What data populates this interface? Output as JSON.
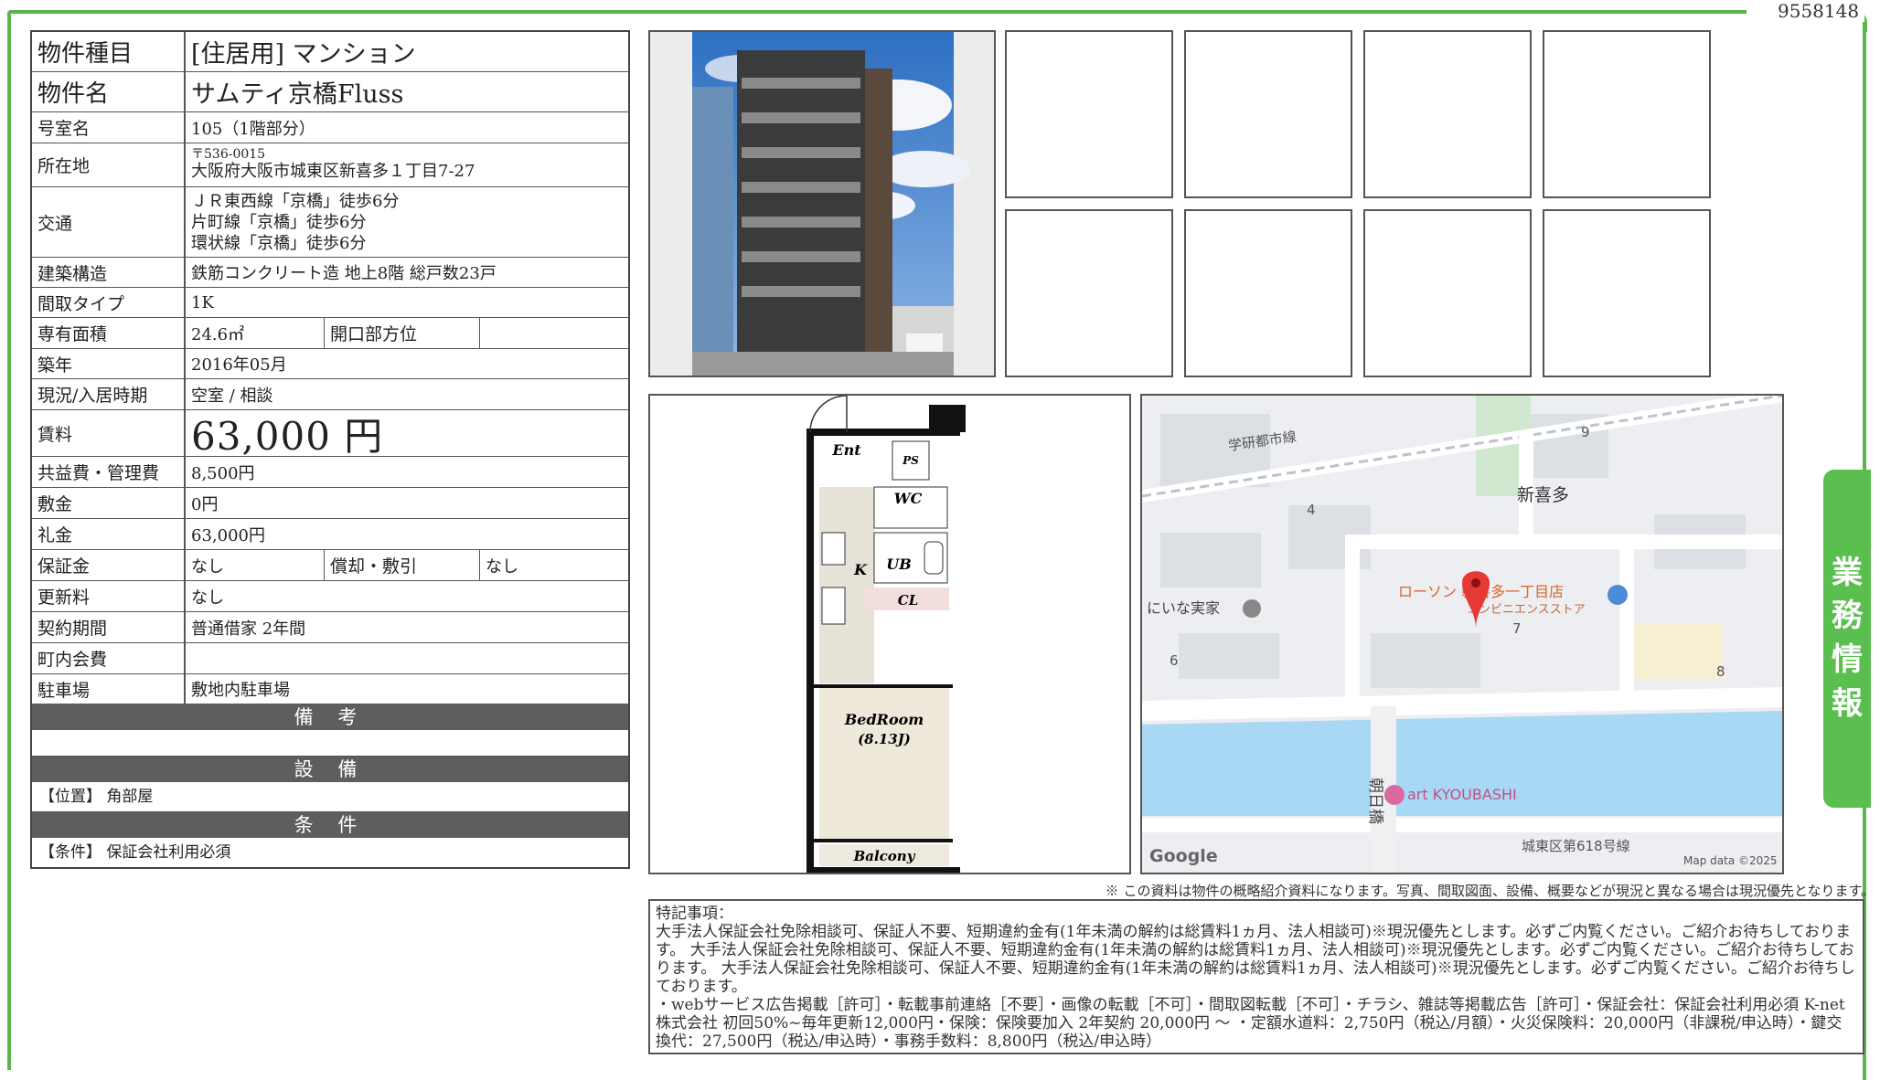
{
  "doc_id": "9558148",
  "side_tab": [
    "業",
    "務",
    "情",
    "報"
  ],
  "property": {
    "type_label": "物件種目",
    "type_value": "[住居用] マンション",
    "name_label": "物件名",
    "name_value": "サムティ京橋Fluss",
    "room_label": "号室名",
    "room_value": "105（1階部分）",
    "address_label": "所在地",
    "postal": "〒536-0015",
    "address": "大阪府大阪市城東区新喜多１丁目7-27",
    "access_label": "交通",
    "access": [
      "ＪＲ東西線「京橋」徒歩6分",
      "片町線「京橋」徒歩6分",
      "環状線「京橋」徒歩6分"
    ],
    "structure_label": "建築構造",
    "structure_value": "鉄筋コンクリート造 地上8階 総戸数23戸",
    "layout_label": "間取タイプ",
    "layout_value": "1K",
    "area_label": "専有面積",
    "area_value": "24.6㎡",
    "direction_label": "開口部方位",
    "direction_value": "",
    "built_label": "築年",
    "built_value": "2016年05月",
    "status_label": "現況/入居時期",
    "status_value": "空室 / 相談",
    "rent_label": "賃料",
    "rent_value": "63,000 円",
    "fee_label": "共益費・管理費",
    "fee_value": "8,500円",
    "deposit_label": "敷金",
    "deposit_value": "0円",
    "keymoney_label": "礼金",
    "keymoney_value": "63,000円",
    "guarantee_label": "保証金",
    "guarantee_value": "なし",
    "amort_label": "償却・敷引",
    "amort_value": "なし",
    "renewal_label": "更新料",
    "renewal_value": "なし",
    "contract_label": "契約期間",
    "contract_value": "普通借家 2年間",
    "community_label": "町内会費",
    "community_value": "",
    "parking_label": "駐車場",
    "parking_value": "敷地内駐車場",
    "remarks_band": "備 考",
    "equipment_band": "設 備",
    "equipment_note": "【位置】 角部屋",
    "conditions_band": "条 件",
    "conditions_note": "【条件】 保証会社利用必須"
  },
  "floorplan": {
    "ent": "Ent",
    "ps": "PS",
    "wc": "WC",
    "ub": "UB",
    "k": "K",
    "cl": "CL",
    "bedroom": "BedRoom",
    "bedroom_size": "(8.13J)",
    "balcony": "Balcony"
  },
  "map": {
    "road_gakken": "学研都市線",
    "area_name": "新喜多",
    "store": "ローソン 新喜多一丁目店",
    "store_sub": "コンビニエンスストア",
    "shop": "にいな実家",
    "bridge": "朝日橋",
    "art": "art KYOUBASHI",
    "route": "城東区第618号線",
    "num_9": "9",
    "num_4": "4",
    "num_6": "6",
    "num_7": "7",
    "num_8": "8",
    "google": "Google",
    "mapdata": "Map data ©2025"
  },
  "disclaimer": "※ この資料は物件の概略紹介資料になります。写真、間取図面、設備、概要などが現況と異なる場合は現況優先となります。",
  "remarks": {
    "title": "特記事項：",
    "body": "大手法人保証会社免除相談可、保証人不要、短期違約金有(1年未満の解約は総賃料1ヵ月、法人相談可)※現況優先とします。必ずご内覧ください。ご紹介お待ちしております。 大手法人保証会社免除相談可、保証人不要、短期違約金有(1年未満の解約は総賃料1ヵ月、法人相談可)※現況優先とします。必ずご内覧ください。ご紹介お待ちしております。 大手法人保証会社免除相談可、保証人不要、短期違約金有(1年未満の解約は総賃料1ヵ月、法人相談可)※現況優先とします。必ずご内覧ください。ご紹介お待ちしております。",
    "line2": "・webサービス広告掲載［許可］・転載事前連絡［不要］・画像の転載［不可］・間取図転載［不可］・チラシ、雑誌等掲載広告［許可］・保証会社：保証会社利用必須 K-net株式会社 初回50%~毎年更新12,000円・保険：保険要加入 2年契約 20,000円 〜 ・定額水道料：2,750円（税込/月額）・火災保険料：20,000円（非課税/申込時）・鍵交換代：27,500円（税込/申込時）・事務手数料：8,800円（税込/申込時）"
  }
}
